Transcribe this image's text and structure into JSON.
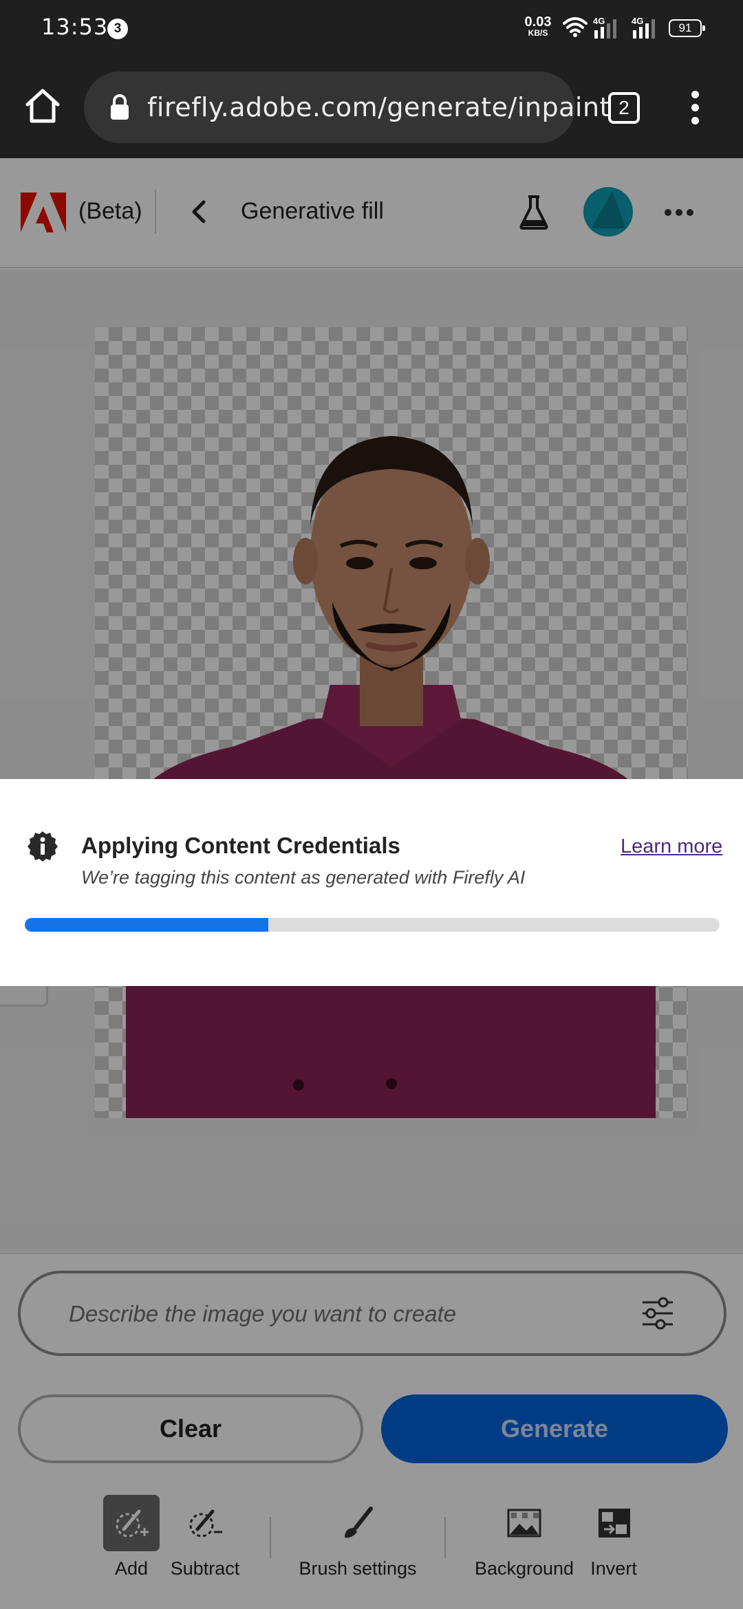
{
  "status_bar": {
    "time": "13:53",
    "notification_count": "3",
    "net_speed_value": "0.03",
    "net_speed_unit": "KB/S",
    "battery": "91",
    "signal_1_label": "4G",
    "signal_2_label": "4G"
  },
  "browser": {
    "url": "firefly.adobe.com/generate/inpaint",
    "tab_count": "2"
  },
  "app_header": {
    "beta_label": "(Beta)",
    "title": "Generative fill"
  },
  "toast": {
    "title": "Applying Content Credentials",
    "subtitle": "We’re tagging this content as generated with Firefly AI",
    "link": "Learn more",
    "progress_fraction": 0.35,
    "progress_color": "#1473e6"
  },
  "prompt": {
    "placeholder": "Describe the image you want to create"
  },
  "actions": {
    "clear": "Clear",
    "generate": "Generate",
    "generate_color": "#0265dc"
  },
  "tools": [
    {
      "label": "Add",
      "icon": "brush-add-icon"
    },
    {
      "label": "Subtract",
      "icon": "brush-subtract-icon"
    },
    {
      "label": "Brush settings",
      "icon": "paintbrush-icon"
    },
    {
      "label": "Background",
      "icon": "background-image-icon"
    },
    {
      "label": "Invert",
      "icon": "invert-icon"
    }
  ],
  "colors": {
    "adobe_red": "#eb1000",
    "avatar": "#0f9fb5",
    "status_bg": "#1f1f1f"
  }
}
